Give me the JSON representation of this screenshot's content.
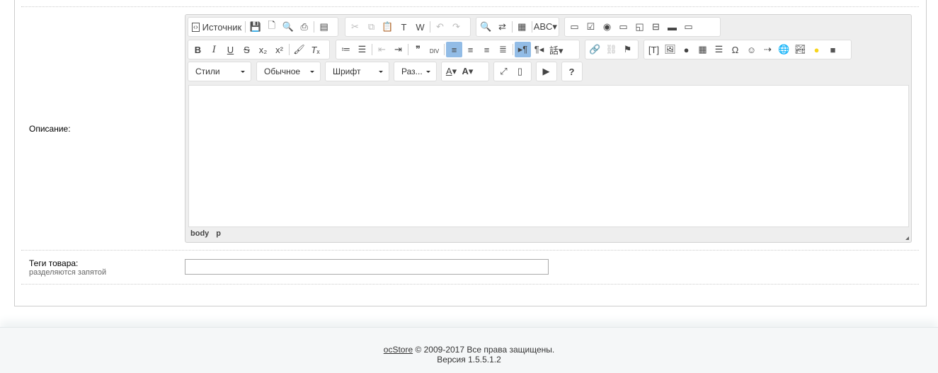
{
  "form": {
    "description_label": "Описание:",
    "tags_label": "Теги товара:",
    "tags_hint": "разделяются запятой",
    "tags_value": ""
  },
  "editor": {
    "source_label": "Источник",
    "combos": [
      "Стили",
      "Обычное",
      "Шрифт",
      "Раз..."
    ],
    "status_path": [
      "body",
      "p"
    ],
    "toolbar": {
      "row1": [
        [
          "save",
          "new-page",
          "preview",
          "print",
          "|",
          "templates"
        ],
        [
          "cut!",
          "copy!",
          "paste",
          "paste-text",
          "paste-word",
          "|",
          "undo!",
          "redo!"
        ],
        [
          "find",
          "replace",
          "|",
          "select-all",
          "|",
          "spellcheck"
        ],
        [
          "form",
          "checkbox",
          "radio",
          "text-field",
          "textarea",
          "select",
          "button",
          "image-button"
        ]
      ],
      "row2": [
        [
          "bold",
          "italic",
          "underline",
          "strike",
          "subscript",
          "superscript",
          "|",
          "copy-format",
          "remove-format"
        ],
        [
          "numbered-list",
          "bulleted-list",
          "|",
          "outdent!",
          "indent",
          "|",
          "blockquote",
          "create-div",
          "|",
          "align-left*",
          "align-center",
          "align-right",
          "align-justify",
          "|",
          "ltr*",
          "rtl",
          "language"
        ],
        [
          "link",
          "unlink!",
          "anchor"
        ],
        [
          "text-box",
          "image",
          "flash",
          "table",
          "horizontal-rule",
          "special-char",
          "smiley",
          "page-break",
          "iframe",
          "image-gallery",
          "yellow-circle",
          "video"
        ]
      ],
      "row3": [
        [
          "text-color",
          "bg-color"
        ],
        [
          "maximize",
          "show-blocks"
        ],
        [
          "play-preview"
        ],
        [
          "help"
        ]
      ]
    }
  },
  "footer": {
    "brand_link": "ocStore",
    "copyright": " © 2009-2017 Все права защищены.",
    "version": "Версия 1.5.5.1.2"
  }
}
